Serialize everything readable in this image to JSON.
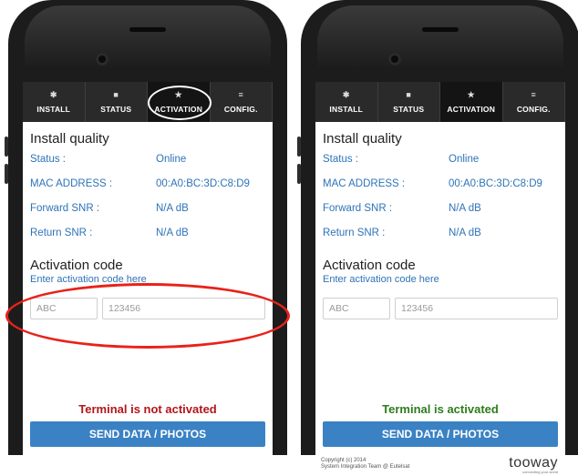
{
  "tabs": [
    {
      "icon": "✱",
      "icon_name": "gear-icon",
      "label": "INSTALL"
    },
    {
      "icon": "■",
      "icon_name": "status-icon",
      "label": "STATUS"
    },
    {
      "icon": "★",
      "icon_name": "star-icon",
      "label": "ACTIVATION"
    },
    {
      "icon": "≡",
      "icon_name": "config-icon",
      "label": "CONFIG."
    }
  ],
  "install_quality": {
    "title": "Install quality",
    "rows": [
      {
        "label": "Status :",
        "value": "Online"
      },
      {
        "label": "MAC ADDRESS :",
        "value": "00:A0:BC:3D:C8:D9"
      },
      {
        "label": "Forward SNR :",
        "value": "N/A dB"
      },
      {
        "label": "Return SNR :",
        "value": "N/A dB"
      }
    ]
  },
  "activation": {
    "title": "Activation code",
    "hint": "Enter activation code here",
    "code_placeholder": "ABC",
    "number_placeholder": "123456"
  },
  "left_screen": {
    "status": "Terminal is not activated",
    "status_color": "#b3161a"
  },
  "right_screen": {
    "status": "Terminal is activated",
    "status_color": "#2e7d1e"
  },
  "send_button": "SEND DATA / PHOTOS",
  "footer": {
    "copyright_line1": "Copyright (c) 2014",
    "copyright_line2": "System Integration Team @ Eutelsat",
    "logo": "tooway",
    "logo_tagline": "connecting your world"
  }
}
